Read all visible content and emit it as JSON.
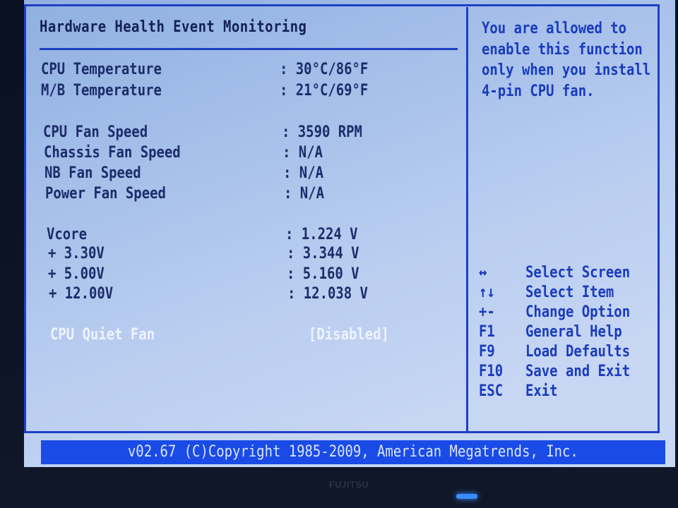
{
  "page": {
    "title": "Hardware Health Event Monitoring"
  },
  "temperatures": [
    {
      "label": "CPU Temperature",
      "value": ": 30°C/86°F"
    },
    {
      "label": "M/B Temperature",
      "value": ": 21°C/69°F"
    }
  ],
  "fans": [
    {
      "label": "CPU Fan Speed",
      "value": ": 3590 RPM"
    },
    {
      "label": "Chassis Fan Speed",
      "value": ": N/A"
    },
    {
      "label": "NB Fan Speed",
      "value": ": N/A"
    },
    {
      "label": "Power Fan Speed",
      "value": ": N/A"
    }
  ],
  "voltages": [
    {
      "label": "Vcore",
      "value": ": 1.224 V"
    },
    {
      "label": "+ 3.30V",
      "value": ": 3.344 V"
    },
    {
      "label": "+ 5.00V",
      "value": ": 5.160 V"
    },
    {
      "label": "+ 12.00V",
      "value": ": 12.038 V"
    }
  ],
  "option": {
    "label": "CPU Quiet Fan",
    "value": "[Disabled]"
  },
  "help": {
    "lines": [
      "You are allowed to",
      "enable this function",
      "only when you install",
      "4-pin CPU fan."
    ]
  },
  "keys": [
    {
      "key": "↔",
      "desc": "Select Screen"
    },
    {
      "key": "↑↓",
      "desc": "Select Item"
    },
    {
      "key": "+-",
      "desc": "Change Option"
    },
    {
      "key": "F1",
      "desc": "General Help"
    },
    {
      "key": "F9",
      "desc": "Load Defaults"
    },
    {
      "key": "F10",
      "desc": "Save and Exit"
    },
    {
      "key": "ESC",
      "desc": "Exit"
    }
  ],
  "footer": {
    "text": "v02.67 (C)Copyright 1985-2009, American Megatrends, Inc."
  },
  "monitor": {
    "brand": "FUJITSU"
  },
  "colors": {
    "accent": "#1f3fc4",
    "footer_bg": "#1a4be6",
    "help_text": "#1a3bbd",
    "item_text": "#1c2c6a",
    "highlight_text": "#eef3ff"
  }
}
